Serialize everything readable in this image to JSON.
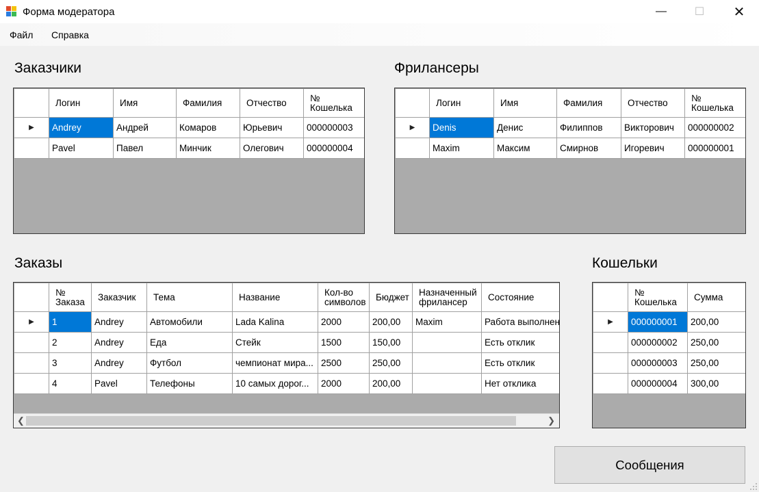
{
  "window": {
    "title": "Форма модератора"
  },
  "menu": {
    "file": "Файл",
    "help": "Справка"
  },
  "customers": {
    "title": "Заказчики",
    "columns": [
      "Логин",
      "Имя",
      "Фамилия",
      "Отчество",
      "№ Кошелька"
    ],
    "rows": [
      [
        "Andrey",
        "Андрей",
        "Комаров",
        "Юрьевич",
        "000000003"
      ],
      [
        "Pavel",
        "Павел",
        "Минчик",
        "Олегович",
        "000000004"
      ]
    ]
  },
  "freelancers": {
    "title": "Фрилансеры",
    "columns": [
      "Логин",
      "Имя",
      "Фамилия",
      "Отчество",
      "№ Кошелька"
    ],
    "rows": [
      [
        "Denis",
        "Денис",
        "Филиппов",
        "Викторович",
        "000000002"
      ],
      [
        "Maxim",
        "Максим",
        "Смирнов",
        "Игоревич",
        "000000001"
      ]
    ]
  },
  "orders": {
    "title": "Заказы",
    "columns": [
      "№ Заказа",
      "Заказчик",
      "Тема",
      "Название",
      "Кол-во символов",
      "Бюджет",
      "Назначенный фрилансер",
      "Состояние"
    ],
    "rows": [
      [
        "1",
        "Andrey",
        "Автомобили",
        "Lada Kalina",
        "2000",
        "200,00",
        "Maxim",
        "Работа выполнена"
      ],
      [
        "2",
        "Andrey",
        "Еда",
        "Стейк",
        "1500",
        "150,00",
        "",
        "Есть отклик"
      ],
      [
        "3",
        "Andrey",
        "Футбол",
        "чемпионат мира...",
        "2500",
        "250,00",
        "",
        "Есть отклик"
      ],
      [
        "4",
        "Pavel",
        "Телефоны",
        "10 самых дорог...",
        "2000",
        "200,00",
        "",
        "Нет отклика"
      ]
    ]
  },
  "wallets": {
    "title": "Кошельки",
    "columns": [
      "№ Кошелька",
      "Сумма"
    ],
    "rows": [
      [
        "000000001",
        "200,00"
      ],
      [
        "000000002",
        "250,00"
      ],
      [
        "000000003",
        "250,00"
      ],
      [
        "000000004",
        "300,00"
      ]
    ]
  },
  "messages_button": "Сообщения",
  "icons": {
    "window_controls": [
      "minimize-icon",
      "maximize-icon",
      "close-icon"
    ],
    "row_indicator": "current-row-arrow-icon",
    "scroll": [
      "scroll-left-icon",
      "scroll-right-icon"
    ]
  },
  "colors": {
    "selection": "#0078d7",
    "grid_empty": "#ababab",
    "window_bg": "#f0f0f0"
  }
}
